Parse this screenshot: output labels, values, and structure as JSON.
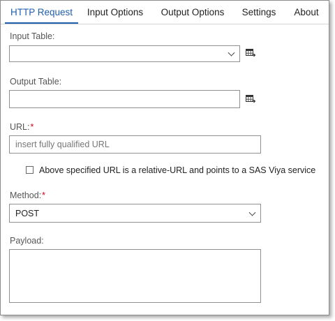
{
  "tabs": [
    {
      "label": "HTTP Request",
      "active": true
    },
    {
      "label": "Input Options",
      "active": false
    },
    {
      "label": "Output Options",
      "active": false
    },
    {
      "label": "Settings",
      "active": false
    },
    {
      "label": "About",
      "active": false
    }
  ],
  "input_table": {
    "label": "Input Table:",
    "value": ""
  },
  "output_table": {
    "label": "Output Table:",
    "value": ""
  },
  "url": {
    "label": "URL:",
    "required_mark": "*",
    "value": "",
    "placeholder": "insert fully qualified URL"
  },
  "relative_url_checkbox": {
    "label": "Above specified URL is a relative-URL and points to a SAS Viya service",
    "checked": false
  },
  "method": {
    "label": "Method:",
    "required_mark": "*",
    "value": "POST"
  },
  "payload": {
    "label": "Payload:",
    "value": ""
  },
  "colors": {
    "accent": "#1f5fae",
    "required": "#d0021b"
  }
}
